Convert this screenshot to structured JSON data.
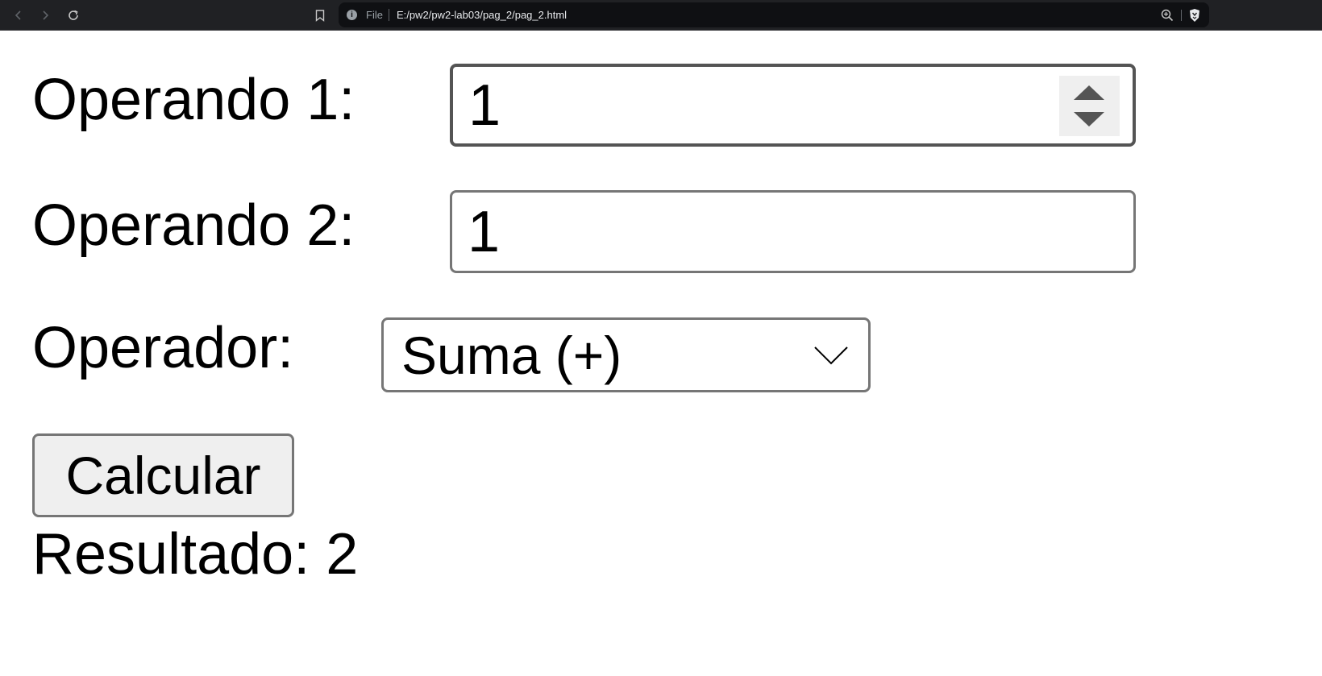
{
  "browser": {
    "address_scheme": "File",
    "url": "E:/pw2/pw2-lab03/pag_2/pag_2.html",
    "icons": {
      "back": "back-arrow-icon",
      "forward": "forward-arrow-icon",
      "reload": "reload-icon",
      "bookmark": "bookmark-icon",
      "info": "info-icon",
      "zoom": "zoom-icon",
      "shield": "brave-shield-icon"
    }
  },
  "form": {
    "operand1": {
      "label": "Operando 1:",
      "value": "1"
    },
    "operand2": {
      "label": "Operando 2:",
      "value": "1"
    },
    "operator": {
      "label": "Operador:",
      "selected": "Suma (+)"
    },
    "calculate_label": "Calcular",
    "result_text": "Resultado: 2"
  },
  "colors": {
    "chrome_bg": "#202124",
    "omnibox_bg": "#0f1013",
    "input_border": "#767676",
    "button_bg": "#efefef"
  }
}
